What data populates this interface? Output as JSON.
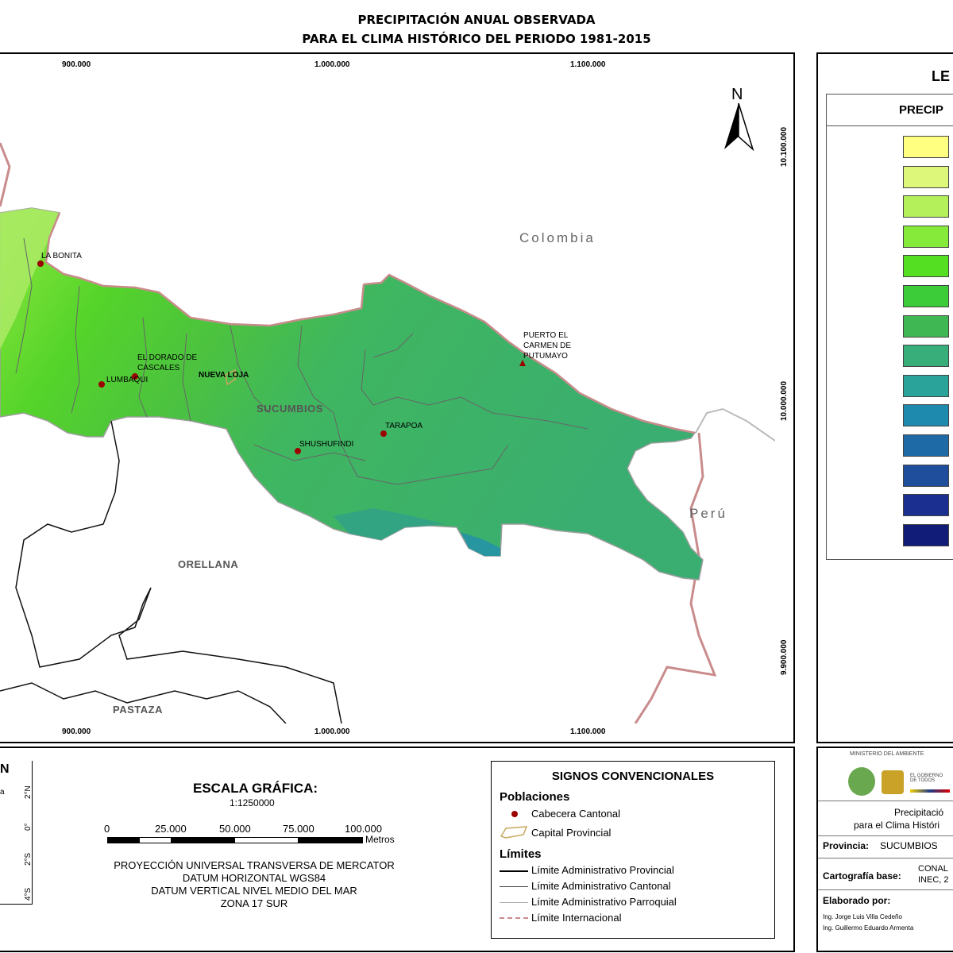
{
  "title": {
    "line1": "PRECIPITACIÓN ANUAL OBSERVADA",
    "line2": "PARA EL CLIMA HISTÓRICO DEL PERIODO 1981-2015"
  },
  "map": {
    "x_ticks_top": [
      "900.000",
      "1.000.000",
      "1.100.000"
    ],
    "x_ticks_bottom": [
      "900.000",
      "1.000.000",
      "1.100.000"
    ],
    "y_ticks": [
      "10.100.000",
      "10.000.000",
      "9.900.000"
    ],
    "north_label": "N",
    "countries": {
      "colombia": "Colombia",
      "peru": "Perú"
    },
    "regions": {
      "sucumbios": "SUCUMBIOS",
      "orellana": "ORELLANA",
      "pastaza": "PASTAZA"
    },
    "places": {
      "la_bonita": "LA BONITA",
      "el_dorado_1": "EL DORADO DE",
      "el_dorado_2": "CASCALES",
      "lumbaqui": "LUMBAQUI",
      "nueva_loja": "NUEVA LOJA",
      "puerto_1": "PUERTO EL",
      "puerto_2": "CARMEN DE",
      "puerto_3": "PUTUMAYO",
      "tarapoa": "TARAPOA",
      "shushufindi": "SHUSHUFINDI"
    },
    "colors": {
      "province_main": "#3fb46a",
      "province_west": "#56d42e",
      "lightgreen": "#9ee85a",
      "border_intl": "#c98b8b"
    }
  },
  "legend": {
    "title": "LE",
    "subtitle": "PRECIP",
    "swatches": [
      "#ffff80",
      "#ddf77a",
      "#b4f05a",
      "#86ea3a",
      "#55df22",
      "#3ccc3a",
      "#3fb854",
      "#38ae7a",
      "#2aa39a",
      "#1e8aae",
      "#1d6aa6",
      "#1f4f9c",
      "#1b2f90",
      "#101c78"
    ]
  },
  "scale": {
    "title": "ESCALA GRÁFICA:",
    "ratio": "1:1250000",
    "labels": [
      "0",
      "25.000",
      "50.000",
      "75.000",
      "100.000"
    ],
    "unit": "Metros",
    "projection": [
      "PROYECCIÓN UNIVERSAL TRANSVERSA DE MERCATOR",
      "DATUM HORIZONTAL WGS84",
      "DATUM VERTICAL NIVEL MEDIO DEL MAR",
      "ZONA 17 SUR"
    ]
  },
  "inset": {
    "n": "N",
    "a": "a",
    "lat": [
      "2°N",
      "0°",
      "2°S",
      "4°S"
    ]
  },
  "signs": {
    "title": "SIGNOS CONVENCIONALES",
    "poblaciones": "Poblaciones",
    "cabecera": "Cabecera Cantonal",
    "capital": "Capital Provincial",
    "limites": "Límites",
    "provincial": "Límite Administrativo Provincial",
    "cantonal": "Límite Administrativo Cantonal",
    "parroquial": "Límite Administrativo Parroquial",
    "internacional": "Límite Internacional"
  },
  "credits": {
    "ministry": "MINISTERIO DEL AMBIENTE",
    "gov": "EL GOBIERNO DE TODOS",
    "desc1": "Precipitació",
    "desc2": "para el Clima Históri",
    "provincia_label": "Provincia:",
    "provincia_value": "SUCUMBIOS",
    "carto_label": "Cartografía base:",
    "carto_v1": "CONAL",
    "carto_v2": "INEC, 2",
    "elaborado": "Elaborado por:",
    "author1": "Ing. Jorge Luis Villa Cedeño",
    "author2": "Ing. Guillermo Eduardo Armenta"
  }
}
